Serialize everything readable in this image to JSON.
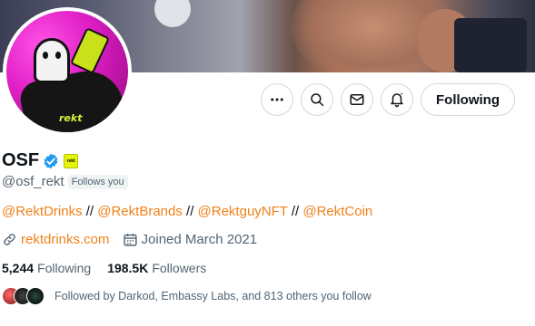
{
  "profile": {
    "display_name": "OSF",
    "handle": "@osf_rekt",
    "follows_you": "Follows you",
    "affiliate_badge_text": "rekt",
    "avatar_text": "rekt",
    "verified": true,
    "bio_parts": [
      {
        "text": "@RektDrinks",
        "link": true
      },
      {
        "text": " // ",
        "link": false
      },
      {
        "text": "@RektBrands",
        "link": true
      },
      {
        "text": " // ",
        "link": false
      },
      {
        "text": "@RektguyNFT",
        "link": true
      },
      {
        "text": " // ",
        "link": false
      },
      {
        "text": "@RektCoin",
        "link": true
      }
    ],
    "website": "rektdrinks.com",
    "joined": "Joined March 2021",
    "following_count": "5,244",
    "following_label": "Following",
    "followers_count": "198.5K",
    "followers_label": "Followers",
    "followed_by": "Followed by Darkod, Embassy Labs, and 813 others you follow"
  },
  "actions": {
    "more_icon": "more-icon",
    "grok_icon": "search-icon",
    "message_icon": "message-icon",
    "notify_icon": "notification-bell-icon",
    "follow_label": "Following"
  },
  "colors": {
    "accent_link": "#f0811a",
    "verified_blue": "#1d9bf0",
    "muted_text": "#536471",
    "border": "#cfd9de"
  }
}
